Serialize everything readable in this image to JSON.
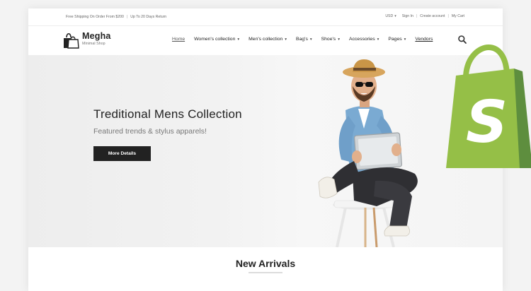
{
  "topbar": {
    "shipping_text": "Free Shipping On Order From $200",
    "separator": "|",
    "return_text": "Up To 20 Days Return",
    "currency": "USD",
    "sign_in": "Sign In",
    "create_account": "Create account",
    "my_cart": "My Cart"
  },
  "brand": {
    "name": "Megha",
    "tagline": "Minimal Shop"
  },
  "nav": {
    "items": [
      {
        "label": "Home"
      },
      {
        "label": "Women's collection"
      },
      {
        "label": "Men's collection"
      },
      {
        "label": "Bag's"
      },
      {
        "label": "Shoe's"
      },
      {
        "label": "Accessories"
      },
      {
        "label": "Pages"
      },
      {
        "label": "Vendors"
      }
    ]
  },
  "hero": {
    "title": "Treditional Mens Collection",
    "subtitle": "Featured trends & stylus apparels!",
    "button_label": "More Details"
  },
  "section": {
    "title": "New Arrivals"
  },
  "colors": {
    "accent_dark": "#222222",
    "shopify_green": "#95bf47",
    "shopify_dark_green": "#5e8e3e"
  },
  "icons": [
    "bag-logo-icon",
    "search-icon",
    "chevron-down-icon",
    "shopify-logo-icon"
  ]
}
